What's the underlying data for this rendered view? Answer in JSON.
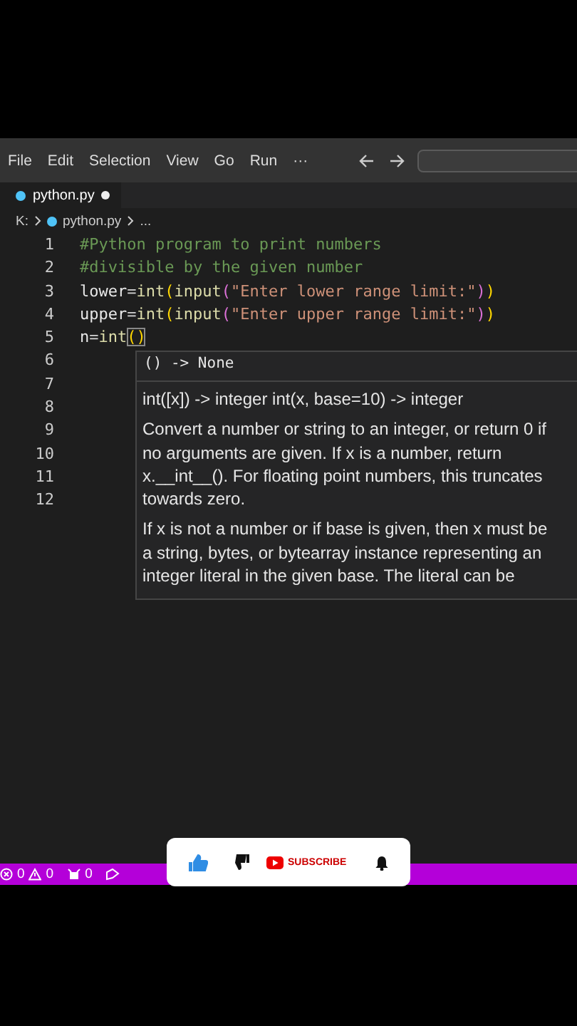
{
  "menu": {
    "items": [
      "File",
      "Edit",
      "Selection",
      "View",
      "Go",
      "Run",
      "···"
    ]
  },
  "tabs": [
    {
      "label": "python.py",
      "selected": true,
      "modified": true
    }
  ],
  "breadcrumb": [
    "K:",
    "python.py",
    "..."
  ],
  "editor": {
    "lines": [
      {
        "number": "1",
        "tokens": [
          {
            "text": "#Python program to print numbers",
            "kind": "comment"
          }
        ]
      },
      {
        "number": "2",
        "tokens": [
          {
            "text": "#divisible by the given number",
            "kind": "comment"
          }
        ]
      },
      {
        "number": "3",
        "tokens": [
          {
            "text": "lower",
            "kind": "var"
          },
          {
            "text": "=",
            "kind": "op"
          },
          {
            "text": "int",
            "kind": "func"
          },
          {
            "text": "(",
            "kind": "paren1"
          },
          {
            "text": "input",
            "kind": "func"
          },
          {
            "text": "(",
            "kind": "paren2"
          },
          {
            "text": "\"Enter lower range limit:\"",
            "kind": "string"
          },
          {
            "text": ")",
            "kind": "paren2"
          },
          {
            "text": ")",
            "kind": "paren1"
          }
        ]
      },
      {
        "number": "4",
        "tokens": [
          {
            "text": "upper",
            "kind": "var"
          },
          {
            "text": "=",
            "kind": "op"
          },
          {
            "text": "int",
            "kind": "func"
          },
          {
            "text": "(",
            "kind": "paren1"
          },
          {
            "text": "input",
            "kind": "func"
          },
          {
            "text": "(",
            "kind": "paren2"
          },
          {
            "text": "\"Enter upper range limit:\"",
            "kind": "string"
          },
          {
            "text": ")",
            "kind": "paren2"
          },
          {
            "text": ")",
            "kind": "paren1"
          }
        ]
      },
      {
        "number": "5",
        "tokens": [
          {
            "text": "n",
            "kind": "var"
          },
          {
            "text": "=",
            "kind": "op"
          },
          {
            "text": "int",
            "kind": "func"
          },
          {
            "text": "()",
            "kind": "match"
          }
        ]
      },
      {
        "number": "6"
      },
      {
        "number": "7"
      },
      {
        "number": "8"
      },
      {
        "number": "9"
      },
      {
        "number": "10"
      },
      {
        "number": "11"
      },
      {
        "number": "12"
      }
    ]
  },
  "hover": {
    "signature": "() -> None",
    "doc": [
      "int([x]) -> integer int(x, base=10) -> integer",
      "Convert a number or string to an integer, or return 0 if no arguments are given. If x is a number, return x.__int__(). For floating point numbers, this truncates towards zero.",
      "If x is not a number or if base is given, then x must be a string, bytes, or bytearray instance representing an integer literal in the given base. The literal can be"
    ]
  },
  "status_bar": {
    "errors": "0",
    "warnings": "0",
    "ports": "0"
  },
  "video_overlay": {
    "liked": true,
    "subscribe": "SUBSCRIBE"
  }
}
